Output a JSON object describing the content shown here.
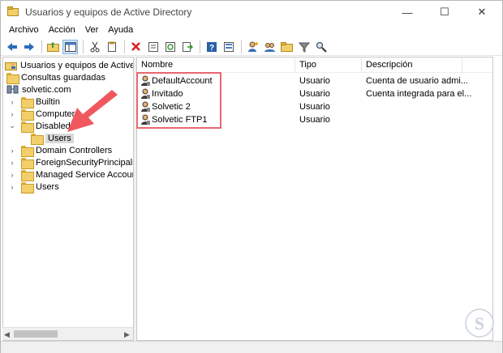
{
  "window": {
    "title": "Usuarios y equipos de Active Directory",
    "controls": {
      "minimize": "—",
      "maximize": "☐",
      "close": "✕"
    }
  },
  "menu": [
    "Archivo",
    "Acción",
    "Ver",
    "Ayuda"
  ],
  "toolbar": {
    "buttons": [
      "back-icon",
      "forward-icon",
      "up-folder-icon",
      "show-console-tree-icon",
      "cut-icon",
      "copy-icon",
      "delete-icon",
      "properties-icon",
      "refresh-icon",
      "export-icon",
      "help-icon",
      "view-icon",
      "new-user-icon",
      "new-group-icon",
      "new-ou-icon",
      "filter-icon",
      "find-icon"
    ]
  },
  "tree": {
    "root": "Usuarios y equipos de Active Directo",
    "saved_queries": "Consultas guardadas",
    "domain": "solvetic.com",
    "nodes": [
      {
        "label": "Builtin",
        "expanded": false
      },
      {
        "label": "Computers",
        "expanded": false
      },
      {
        "label": "Disabled",
        "expanded": true
      },
      {
        "label": "Users",
        "child": true,
        "selected": true
      },
      {
        "label": "Domain Controllers",
        "expanded": false
      },
      {
        "label": "ForeignSecurityPrincipals",
        "expanded": false
      },
      {
        "label": "Managed Service Accounts",
        "expanded": false
      },
      {
        "label": "Users",
        "expanded": false
      }
    ]
  },
  "list": {
    "columns": [
      "Nombre",
      "Tipo",
      "Descripción"
    ],
    "rows": [
      {
        "name": "DefaultAccount",
        "type": "Usuario",
        "description": "Cuenta de usuario admi..."
      },
      {
        "name": "Invitado",
        "type": "Usuario",
        "description": "Cuenta integrada para el..."
      },
      {
        "name": "Solvetic 2",
        "type": "Usuario",
        "description": ""
      },
      {
        "name": "Solvetic FTP1",
        "type": "Usuario",
        "description": ""
      }
    ]
  },
  "colors": {
    "annotation": "#f0575e",
    "highlight": "#e8676f",
    "folder": "#f3cf6a"
  }
}
